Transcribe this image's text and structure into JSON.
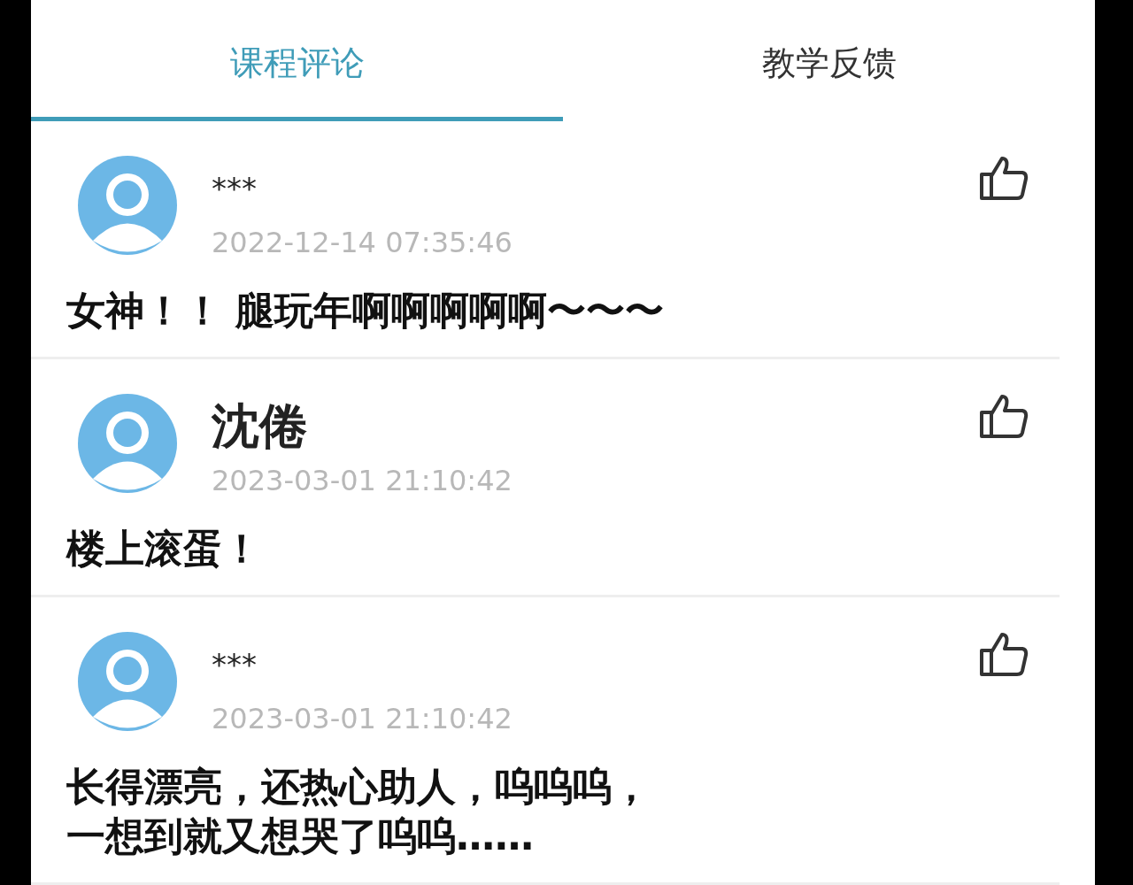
{
  "tabs": [
    {
      "label": "课程评论",
      "selected": true
    },
    {
      "label": "教学反馈",
      "selected": false
    }
  ],
  "comments": [
    {
      "kind": "masked",
      "name": "***",
      "time": "2022-12-14 07:35:46",
      "lines": [
        "女神！！ 腿玩年啊啊啊啊啊〜〜〜"
      ]
    },
    {
      "kind": "named",
      "name": "沈倦",
      "time": "2023-03-01 21:10:42",
      "lines": [
        "楼上滚蛋！"
      ]
    },
    {
      "kind": "masked",
      "name": "***",
      "time": "2023-03-01 21:10:42",
      "lines": [
        "长得漂亮，还热心助人，呜呜呜，",
        "一想到就又想哭了呜呜……"
      ]
    }
  ]
}
